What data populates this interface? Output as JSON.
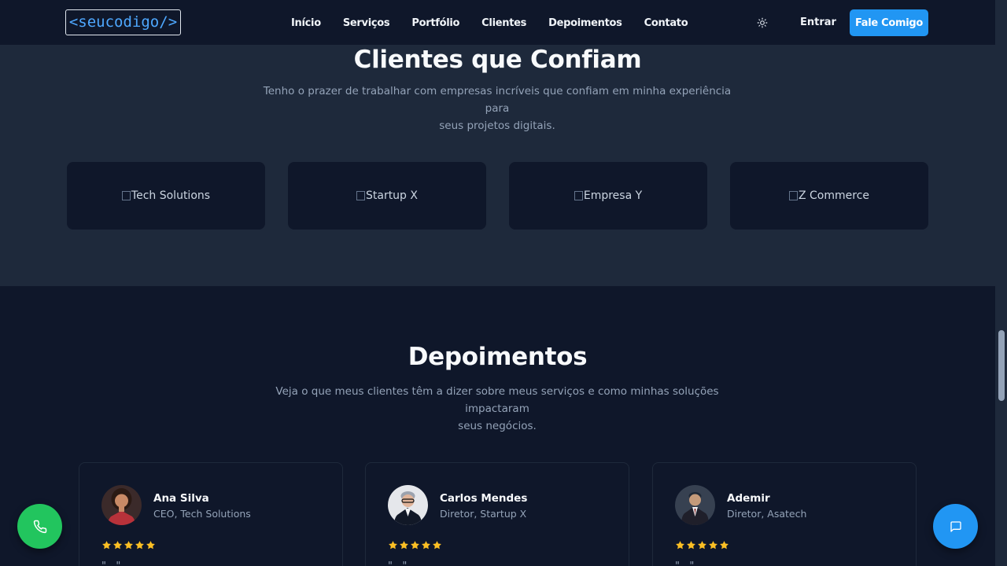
{
  "header": {
    "logo": "<seucodigo/>",
    "nav": [
      "Início",
      "Serviços",
      "Portfólio",
      "Clientes",
      "Depoimentos",
      "Contato"
    ],
    "theme_icon": "sun-icon",
    "login": "Entrar",
    "cta": "Fale Comigo"
  },
  "clients": {
    "title": "Clientes que Confiam",
    "subtitle_line1": "Tenho o prazer de trabalhar com empresas incríveis que confiam em minha experiência para",
    "subtitle_line2": "seus projetos digitais.",
    "logos": [
      "Tech Solutions",
      "Startup X",
      "Empresa Y",
      "Z Commerce"
    ]
  },
  "testimonials": {
    "title": "Depoimentos",
    "subtitle_line1": "Veja o que meus clientes têm a dizer sobre meus serviços e como minhas soluções impactaram",
    "subtitle_line2": "seus negócios.",
    "items": [
      {
        "name": "Ana Silva",
        "role": "CEO, Tech Solutions",
        "rating": 5,
        "text": "\"...\""
      },
      {
        "name": "Carlos Mendes",
        "role": "Diretor, Startup X",
        "rating": 5,
        "text": "\"...\""
      },
      {
        "name": "Ademir",
        "role": "Diretor, Asatech",
        "rating": 5,
        "text": "\"...\""
      }
    ]
  },
  "fabs": {
    "phone_icon": "phone-icon",
    "chat_icon": "chat-icon"
  },
  "colors": {
    "accent": "#2196f3",
    "whatsapp": "#22c55e",
    "star": "#fbbf24",
    "bg": "#0f172a",
    "section_bg": "#1e293b"
  }
}
